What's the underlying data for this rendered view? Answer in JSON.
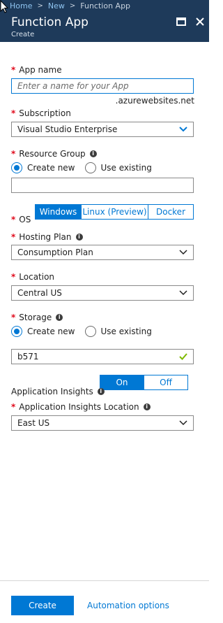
{
  "breadcrumb": {
    "items": [
      "Home",
      "New",
      "Function App"
    ]
  },
  "header": {
    "title": "Function App",
    "subtitle": "Create"
  },
  "form": {
    "app_name": {
      "label": "App name",
      "placeholder": "Enter a name for your App",
      "suffix": ".azurewebsites.net"
    },
    "subscription": {
      "label": "Subscription",
      "value": "Visual Studio Enterprise"
    },
    "resource_group": {
      "label": "Resource Group",
      "options": [
        "Create new",
        "Use existing"
      ],
      "selected": "Create new",
      "value": ""
    },
    "os": {
      "label": "OS",
      "options": [
        "Windows",
        "Linux (Preview)",
        "Docker"
      ],
      "selected": "Windows"
    },
    "hosting_plan": {
      "label": "Hosting Plan",
      "value": "Consumption Plan"
    },
    "location": {
      "label": "Location",
      "value": "Central US"
    },
    "storage": {
      "label": "Storage",
      "options": [
        "Create new",
        "Use existing"
      ],
      "selected": "Create new",
      "value": "b571"
    },
    "app_insights": {
      "label": "Application Insights",
      "options": [
        "On",
        "Off"
      ],
      "selected": "On"
    },
    "app_insights_location": {
      "label": "Application Insights Location",
      "value": "East US"
    }
  },
  "footer": {
    "create_label": "Create",
    "automation_label": "Automation options"
  },
  "colors": {
    "header_bg": "#1e3a5a",
    "accent": "#0078d4",
    "required": "#e00b1c",
    "valid": "#7fba00"
  },
  "icons": [
    "cursor-icon",
    "maximize-icon",
    "close-icon",
    "info-icon",
    "chevron-down-icon",
    "checkmark-icon"
  ]
}
